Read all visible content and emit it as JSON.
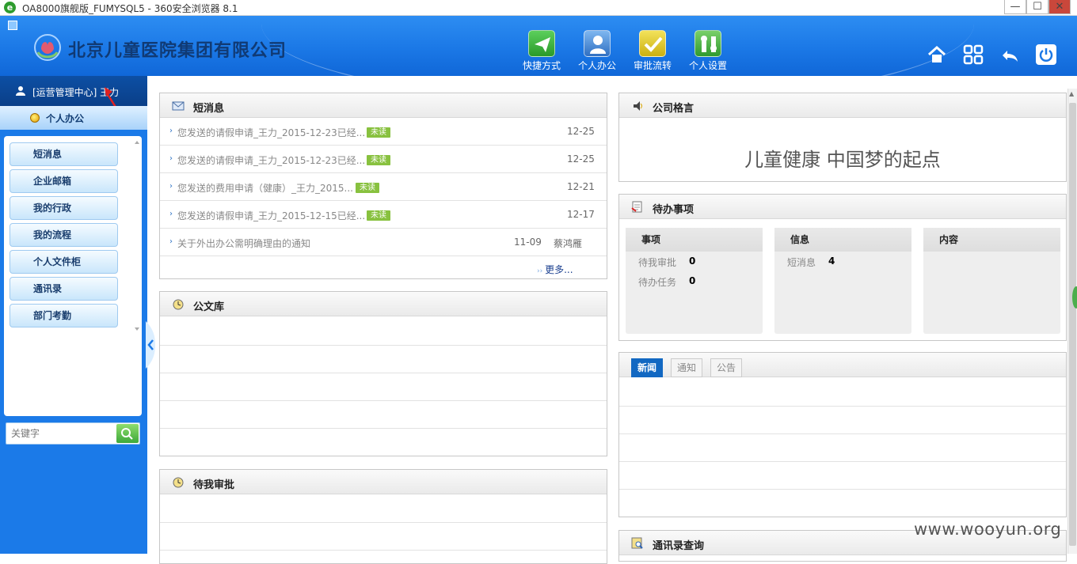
{
  "window": {
    "title": "OA8000旗舰版_FUMYSQL5 - 360安全浏览器 8.1",
    "browser_icon": "e",
    "min_label": "—",
    "max_label": "☐",
    "close_label": "✕"
  },
  "header": {
    "company_name": "北京儿童医院集团有限公司",
    "nav": [
      {
        "label": "快捷方式",
        "icon": "paper-plane-icon"
      },
      {
        "label": "个人办公",
        "icon": "person-icon"
      },
      {
        "label": "审批流转",
        "icon": "checkmark-icon"
      },
      {
        "label": "个人设置",
        "icon": "tools-icon"
      }
    ],
    "top_icons": [
      "home-icon",
      "apps-grid-icon",
      "undo-icon",
      "power-icon"
    ]
  },
  "sidebar": {
    "user_label": "[运营管理中心] 王力",
    "section_title": "个人办公",
    "menu": [
      "短消息",
      "企业邮箱",
      "我的行政",
      "我的流程",
      "个人文件柜",
      "通讯录",
      "部门考勤"
    ],
    "search_placeholder": "关键字"
  },
  "messages": {
    "title": "短消息",
    "rows": [
      {
        "text": "您发送的请假申请_王力_2015-12-23已经...",
        "badge": "未读",
        "date": "12-25"
      },
      {
        "text": "您发送的请假申请_王力_2015-12-23已经...",
        "badge": "未读",
        "date": "12-25"
      },
      {
        "text": "您发送的费用申请（健康）_王力_2015...",
        "badge": "未读",
        "date": "12-21"
      },
      {
        "text": "您发送的请假申请_王力_2015-12-15已经...",
        "badge": "未读",
        "date": "12-17"
      }
    ],
    "notice_row": {
      "text": "关于外出办公需明确理由的通知",
      "date": "11-09",
      "author": "蔡鸿雁"
    },
    "more_label": "更多..."
  },
  "library": {
    "title": "公文库"
  },
  "pending_approval": {
    "title": "待我审批"
  },
  "motto": {
    "title": "公司格言",
    "text": "儿童健康 中国梦的起点"
  },
  "todo": {
    "title": "待办事项",
    "cards": [
      {
        "header": "事项",
        "rows": [
          {
            "label": "待我审批",
            "value": "0"
          },
          {
            "label": "待办任务",
            "value": "0"
          }
        ]
      },
      {
        "header": "信息",
        "rows": [
          {
            "label": "短消息",
            "value": "4"
          }
        ]
      },
      {
        "header": "内容",
        "rows": []
      }
    ]
  },
  "news": {
    "tabs": [
      "新闻",
      "通知",
      "公告"
    ],
    "active_tab": 0
  },
  "contacts": {
    "title": "通讯录查询"
  },
  "watermark": "www.wooyun.org",
  "colors": {
    "header_blue": "#1b78e6",
    "sidebar_blue": "#1b7ae8",
    "badge_green": "#88c13f",
    "active_tab": "#1268c2"
  }
}
